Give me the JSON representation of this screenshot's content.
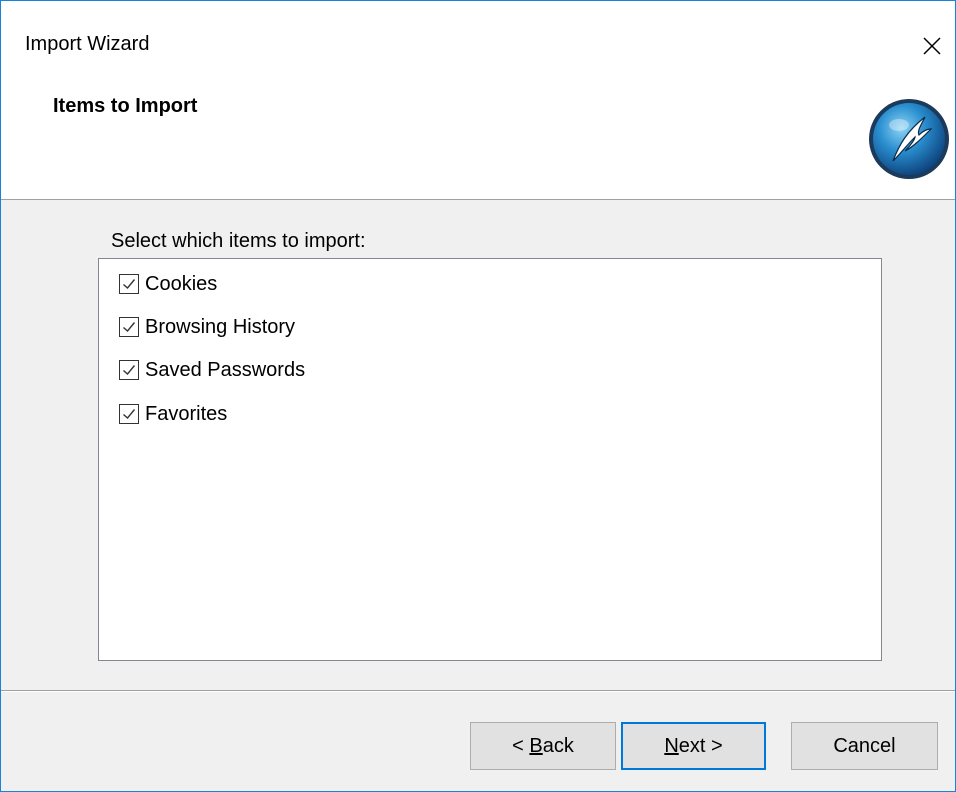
{
  "window": {
    "title": "Import Wizard",
    "close_icon": "close-icon"
  },
  "header": {
    "title": "Items to Import",
    "logo_icon": "comodo-dragon-logo"
  },
  "main": {
    "instruction": "Select which items to import:",
    "items": [
      {
        "label": "Cookies",
        "checked": true
      },
      {
        "label": "Browsing History",
        "checked": true
      },
      {
        "label": "Saved Passwords",
        "checked": true
      },
      {
        "label": "Favorites",
        "checked": true
      }
    ]
  },
  "footer": {
    "back_mnemonic": "B",
    "back_prefix": "< ",
    "back_rest": "ack",
    "next_mnemonic": "N",
    "next_rest": "ext >",
    "cancel_label": "Cancel"
  },
  "colors": {
    "accent": "#0078d7",
    "window_border": "#1883d7",
    "dialog_bg": "#f0f0f0"
  }
}
